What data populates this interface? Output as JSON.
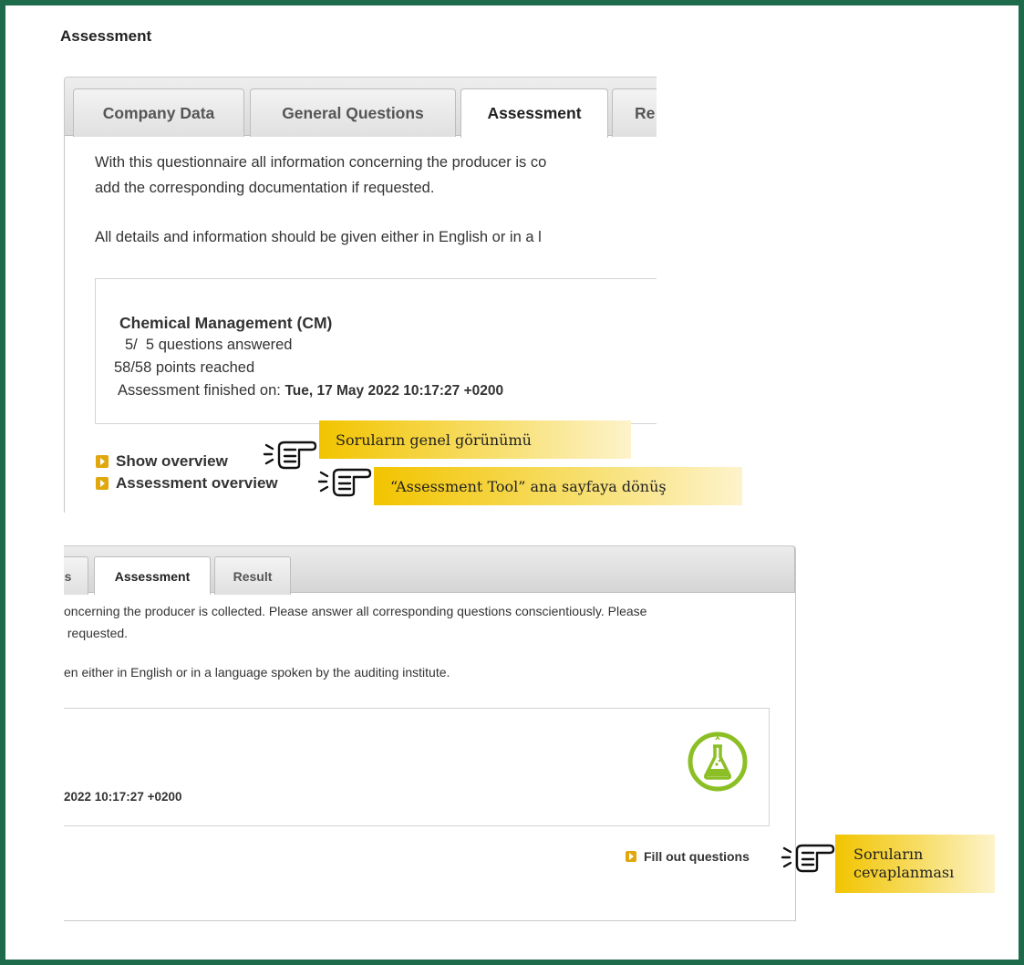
{
  "page": {
    "title": "Assessment"
  },
  "top_panel": {
    "tabs": [
      "Company Data",
      "General Questions",
      "Assessment",
      "Re"
    ],
    "active_tab": "Assessment",
    "intro_line1": "With this questionnaire all information concerning the producer is co",
    "intro_line2": "add the corresponding documentation if requested.",
    "intro_line3": "All details and information should be given either in English or in a l",
    "module": {
      "title": "Chemical Management (CM)",
      "answered_count": "5/  5",
      "answered_label": "questions answered",
      "points_count": "58/58",
      "points_label": "points reached",
      "finished_label": "Assessment finished on:",
      "finished_date": "Tue, 17 May 2022 10:17:27 +0200"
    },
    "links": {
      "show_overview": "Show overview",
      "assessment_overview": "Assessment overview"
    }
  },
  "callouts": {
    "show_overview": "Soruların genel görünümü",
    "assessment_overview": "“Assessment Tool” ana sayfaya dönüş",
    "fill_out_line1": "Soruların",
    "fill_out_line2": "cevaplanması"
  },
  "bottom_panel": {
    "tabs": [
      "s",
      "Assessment",
      "Result"
    ],
    "active_tab": "Assessment",
    "intro_line1": "oncerning the producer is collected. Please answer all corresponding questions conscientiously. Please",
    "intro_line2": " requested.",
    "intro_line3": "en either in English or in a language spoken by the auditing institute.",
    "finished_date": "2022 10:17:27 +0200",
    "fill_out_link": "Fill out questions"
  },
  "colors": {
    "frame_border": "#1e6b4c",
    "accent_bullet": "#e0a80c",
    "callout_yellow": "#f2c400",
    "flask_green": "#8cbf26"
  },
  "icons": [
    "arrow-bullet-icon",
    "pointing-hand-icon",
    "flask-icon"
  ]
}
